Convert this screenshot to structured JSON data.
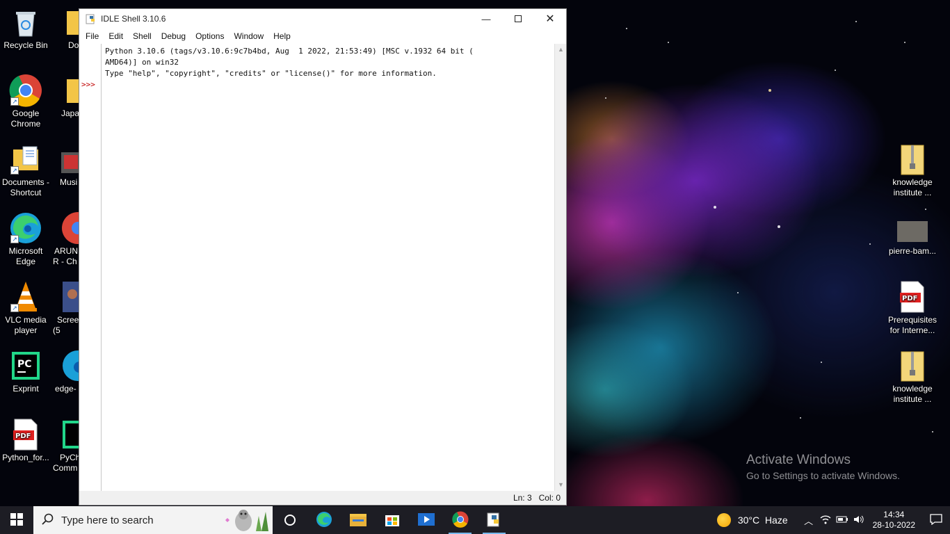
{
  "desktop": {
    "left_icons": [
      {
        "label": "Recycle Bin"
      },
      {
        "label": "Google Chrome"
      },
      {
        "label": "Documents - Shortcut"
      },
      {
        "label": "Microsoft Edge"
      },
      {
        "label": "VLC media player"
      },
      {
        "label": "Exprint"
      },
      {
        "label": "Python_for..."
      }
    ],
    "second_col_icons": [
      {
        "label": "Do"
      },
      {
        "label": "Japa"
      },
      {
        "label": "Musi"
      },
      {
        "label": "ARUN R - Ch"
      },
      {
        "label": "Scree (5"
      },
      {
        "label": "edge-"
      },
      {
        "label": "PyCh Comm"
      }
    ],
    "right_icons": [
      {
        "label": "knowledge institute ..."
      },
      {
        "label": "pierre-bam..."
      },
      {
        "label": "Prerequisites for Interne..."
      },
      {
        "label": "knowledge institute ..."
      }
    ]
  },
  "idle_window": {
    "title": "IDLE Shell 3.10.6",
    "menu": [
      "File",
      "Edit",
      "Shell",
      "Debug",
      "Options",
      "Window",
      "Help"
    ],
    "shell_text": "Python 3.10.6 (tags/v3.10.6:9c7b4bd, Aug  1 2022, 21:53:49) [MSC v.1932 64 bit (\nAMD64)] on win32\nType \"help\", \"copyright\", \"credits\" or \"license()\" for more information.",
    "prompt": ">>>",
    "status": {
      "line": "Ln: 3",
      "col": "Col: 0"
    }
  },
  "watermark": {
    "line1": "Activate Windows",
    "line2": "Go to Settings to activate Windows."
  },
  "taskbar": {
    "search_placeholder": "Type here to search",
    "weather": "30°C  Haze",
    "time": "14:34",
    "date": "28-10-2022"
  }
}
